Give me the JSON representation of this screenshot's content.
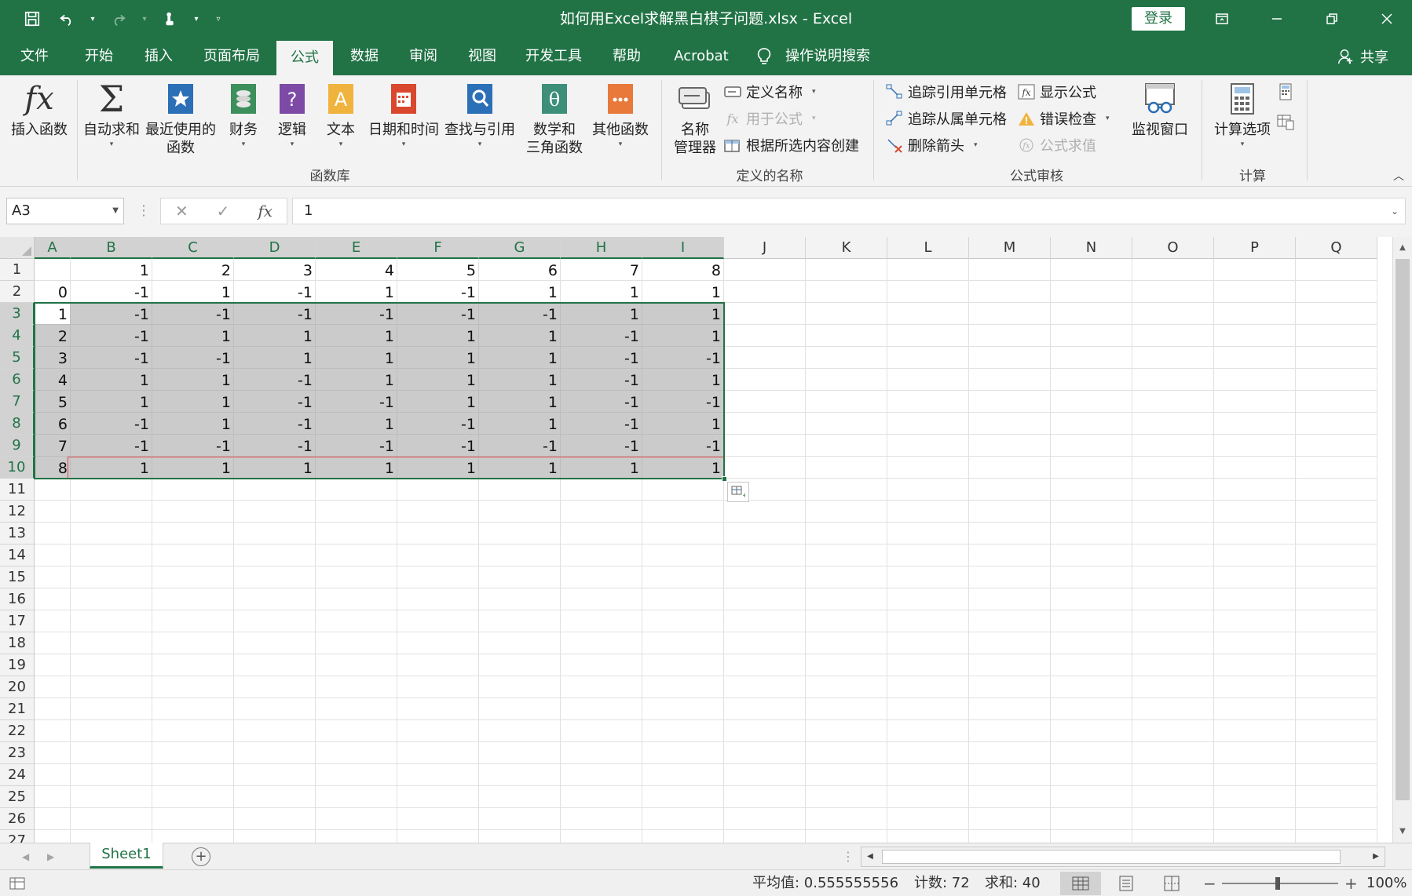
{
  "window": {
    "title": "如何用Excel求解黑白棋子问题.xlsx  -  Excel",
    "login_label": "登录",
    "share_label": "共享"
  },
  "menu_tabs": [
    "文件",
    "开始",
    "插入",
    "页面布局",
    "公式",
    "数据",
    "审阅",
    "视图",
    "开发工具",
    "帮助",
    "Acrobat"
  ],
  "active_tab": "公式",
  "search_label": "操作说明搜索",
  "ribbon": {
    "function_library": {
      "label": "函数库",
      "buttons": [
        "插入函数",
        "自动求和",
        "最近使用的\n函数",
        "财务",
        "逻辑",
        "文本",
        "日期和时间",
        "查找与引用",
        "数学和\n三角函数",
        "其他函数"
      ]
    },
    "defined_names": {
      "label": "定义的名称",
      "name_manager": "名称\n管理器",
      "define_name": "定义名称",
      "use_in_formula": "用于公式",
      "create_from_selection": "根据所选内容创建"
    },
    "formula_auditing": {
      "label": "公式审核",
      "trace_precedents": "追踪引用单元格",
      "trace_dependents": "追踪从属单元格",
      "remove_arrows": "删除箭头",
      "show_formulas": "显示公式",
      "error_checking": "错误检查",
      "evaluate_formula": "公式求值",
      "watch_window": "监视窗口"
    },
    "calculation": {
      "label": "计算",
      "calc_options": "计算选项"
    },
    "colors": {
      "accent": "#217346",
      "ribbon_bg": "#f3f3f3"
    }
  },
  "formula_bar": {
    "name_box": "A3",
    "value": "1"
  },
  "grid": {
    "columns": [
      "A",
      "B",
      "C",
      "D",
      "E",
      "F",
      "G",
      "H",
      "I",
      "J",
      "K",
      "L",
      "M",
      "N",
      "O",
      "P",
      "Q"
    ],
    "row_count": 27,
    "cells": [
      [
        "",
        "1",
        "2",
        "3",
        "4",
        "5",
        "6",
        "7",
        "8"
      ],
      [
        "0",
        "-1",
        "1",
        "-1",
        "1",
        "-1",
        "1",
        "1",
        "1"
      ],
      [
        "1",
        "-1",
        "-1",
        "-1",
        "-1",
        "-1",
        "-1",
        "1",
        "1"
      ],
      [
        "2",
        "-1",
        "1",
        "1",
        "1",
        "1",
        "1",
        "-1",
        "1"
      ],
      [
        "3",
        "-1",
        "-1",
        "1",
        "1",
        "1",
        "1",
        "-1",
        "-1"
      ],
      [
        "4",
        "1",
        "1",
        "-1",
        "1",
        "1",
        "1",
        "-1",
        "1"
      ],
      [
        "5",
        "1",
        "1",
        "-1",
        "-1",
        "1",
        "1",
        "-1",
        "-1"
      ],
      [
        "6",
        "-1",
        "1",
        "-1",
        "1",
        "-1",
        "1",
        "-1",
        "1"
      ],
      [
        "7",
        "-1",
        "-1",
        "-1",
        "-1",
        "-1",
        "-1",
        "-1",
        "-1"
      ],
      [
        "8",
        "1",
        "1",
        "1",
        "1",
        "1",
        "1",
        "1",
        "1"
      ]
    ],
    "selection": "A3:I10"
  },
  "sheets": [
    "Sheet1"
  ],
  "status": {
    "average": "平均值: 0.555555556",
    "count": "计数: 72",
    "sum": "求和: 40",
    "zoom": "100%"
  }
}
